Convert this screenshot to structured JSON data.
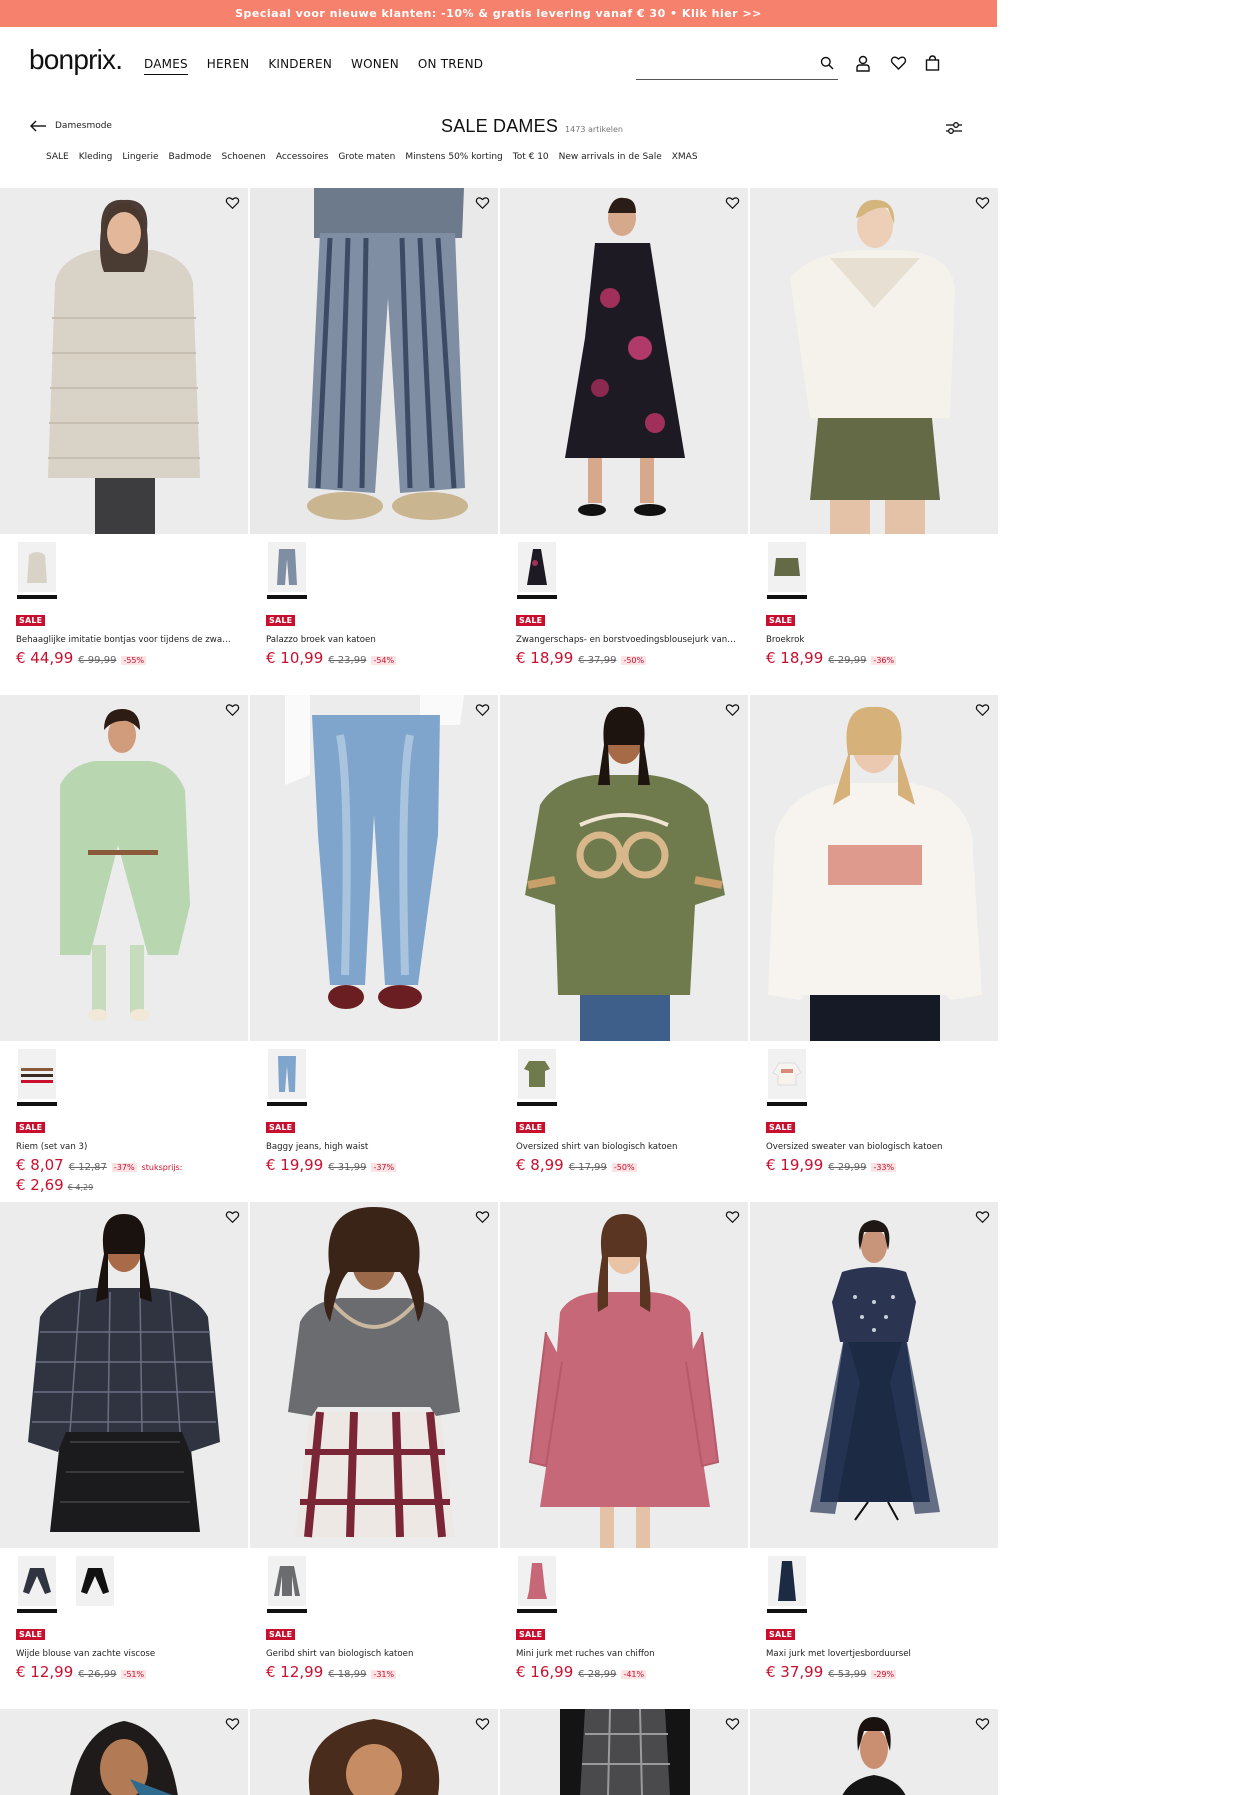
{
  "promo_banner": "Speciaal voor nieuwe klanten: -10% & gratis levering vanaf € 30 • Klik hier >>",
  "logo": "bonprix.",
  "nav": [
    "DAMES",
    "HEREN",
    "KINDEREN",
    "WONEN",
    "ON TREND"
  ],
  "nav_active": "DAMES",
  "search": {
    "value": "",
    "placeholder": ""
  },
  "header_icons": [
    "search-icon",
    "user-icon",
    "heart-icon",
    "bag-icon"
  ],
  "back_link": "Damesmode",
  "page_title": "SALE DAMES",
  "article_count": "1473 artikelen",
  "categories": [
    "SALE",
    "Kleding",
    "Lingerie",
    "Badmode",
    "Schoenen",
    "Accessoires",
    "Grote maten",
    "Minstens 50% korting",
    "Tot € 10",
    "New arrivals in de Sale",
    "XMAS"
  ],
  "colors": {
    "promo": "#f6826e",
    "sale_red": "#c8102e"
  },
  "products": [
    {
      "name": "Behaaglijke imitatie bontjas voor tijdens de zwangerschap",
      "badge": "SALE",
      "price": "€ 44,99",
      "old_price": "€ 99,99",
      "discount": "-55%",
      "swatch_count": 1
    },
    {
      "name": "Palazzo broek van katoen",
      "badge": "SALE",
      "price": "€ 10,99",
      "old_price": "€ 23,99",
      "discount": "-54%",
      "swatch_count": 1
    },
    {
      "name": "Zwangerschaps- en borstvoedingsblousejurk van zachte viscose",
      "badge": "SALE",
      "price": "€ 18,99",
      "old_price": "€ 37,99",
      "discount": "-50%",
      "swatch_count": 1
    },
    {
      "name": "Broekrok",
      "badge": "SALE",
      "price": "€ 18,99",
      "old_price": "€ 29,99",
      "discount": "-36%",
      "swatch_count": 1
    },
    {
      "name": "Riem (set van 3)",
      "badge": "SALE",
      "price": "€ 8,07",
      "old_price": "€ 12,87",
      "discount": "-37%",
      "unit_label": "stuksprijs:",
      "unit_price": "€ 2,69",
      "unit_old_price": "€ 4,29",
      "swatch_count": 1
    },
    {
      "name": "Baggy jeans, high waist",
      "badge": "SALE",
      "price": "€ 19,99",
      "old_price": "€ 31,99",
      "discount": "-37%",
      "swatch_count": 1
    },
    {
      "name": "Oversized shirt van biologisch katoen",
      "badge": "SALE",
      "price": "€ 8,99",
      "old_price": "€ 17,99",
      "discount": "-50%",
      "swatch_count": 1
    },
    {
      "name": "Oversized sweater van biologisch katoen",
      "badge": "SALE",
      "price": "€ 19,99",
      "old_price": "€ 29,99",
      "discount": "-33%",
      "swatch_count": 1
    },
    {
      "name": "Wijde blouse van zachte viscose",
      "badge": "SALE",
      "price": "€ 12,99",
      "old_price": "€ 26,99",
      "discount": "-51%",
      "swatch_count": 2
    },
    {
      "name": "Geribd shirt van biologisch katoen",
      "badge": "SALE",
      "price": "€ 12,99",
      "old_price": "€ 18,99",
      "discount": "-31%",
      "swatch_count": 1
    },
    {
      "name": "Mini jurk met ruches van chiffon",
      "badge": "SALE",
      "price": "€ 16,99",
      "old_price": "€ 28,99",
      "discount": "-41%",
      "swatch_count": 1
    },
    {
      "name": "Maxi jurk met lovertjesborduursel",
      "badge": "SALE",
      "price": "€ 37,99",
      "old_price": "€ 53,99",
      "discount": "-29%",
      "swatch_count": 1
    }
  ]
}
